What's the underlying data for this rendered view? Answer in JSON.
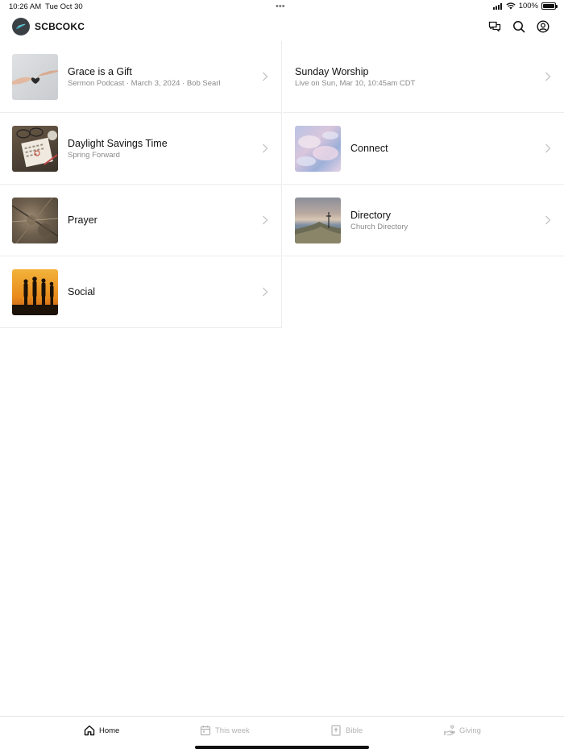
{
  "status_bar": {
    "time": "10:26 AM",
    "date": "Tue Oct 30",
    "battery": "100%"
  },
  "header": {
    "app_name": "SCBCOKC",
    "icons": [
      "chat-icon",
      "search-icon",
      "account-icon"
    ]
  },
  "left_column": [
    {
      "title": "Grace is a Gift",
      "subtitle": "Sermon Podcast · March 3, 2024 · Bob Searl",
      "thumb": "hands-heart"
    },
    {
      "title": "Daylight Savings Time",
      "subtitle": "Spring Forward",
      "thumb": "calendar-desk"
    },
    {
      "title": "Prayer",
      "subtitle": "",
      "thumb": "forest-floor"
    },
    {
      "title": "Social",
      "subtitle": "",
      "thumb": "sunset-silhouettes"
    }
  ],
  "right_column": [
    {
      "title": "Sunday Worship",
      "subtitle": "Live on Sun, Mar 10, 10:45am CDT",
      "thumb": ""
    },
    {
      "title": "Connect",
      "subtitle": "",
      "thumb": "pink-clouds"
    },
    {
      "title": "Directory",
      "subtitle": "Church Directory",
      "thumb": "mountain-cross"
    }
  ],
  "tabs": [
    {
      "label": "Home",
      "icon": "home-icon",
      "active": true
    },
    {
      "label": "This week",
      "icon": "calendar-icon",
      "active": false
    },
    {
      "label": "Bible",
      "icon": "bible-icon",
      "active": false
    },
    {
      "label": "Giving",
      "icon": "giving-icon",
      "active": false
    }
  ],
  "colors": {
    "accent": "#111111",
    "inactive": "#b3b3b3",
    "divider": "#ececec",
    "logo_bg": "#3a3f44",
    "logo_mark": "#3fb6c8"
  }
}
